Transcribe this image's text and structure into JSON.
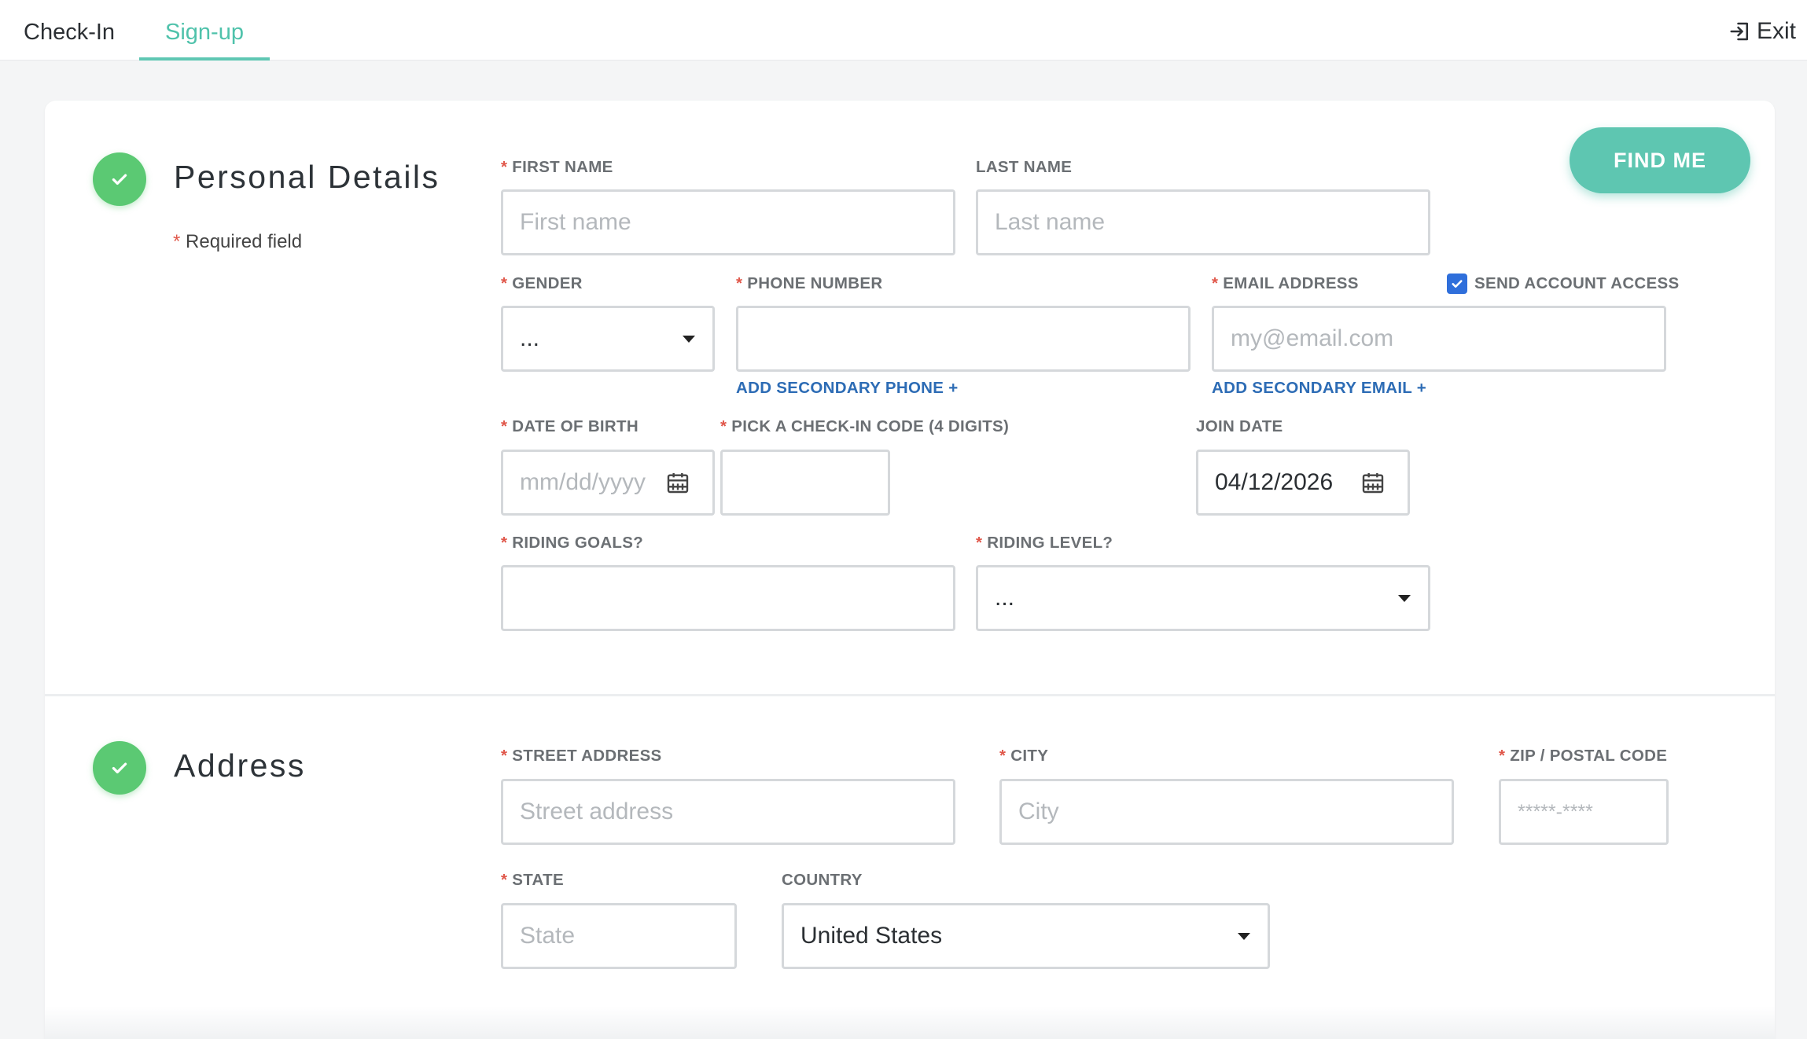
{
  "header": {
    "tabs": [
      {
        "label": "Check-In",
        "active": false
      },
      {
        "label": "Sign-up",
        "active": true
      }
    ],
    "exit_label": "Exit",
    "accent_color": "#4fc2ab"
  },
  "personal": {
    "title": "Personal Details",
    "required_star": "*",
    "required_note": "Required field",
    "find_me_label": "FIND ME",
    "first_name": {
      "label": "FIRST NAME",
      "placeholder": "First name"
    },
    "last_name": {
      "label": "LAST NAME",
      "placeholder": "Last name"
    },
    "gender": {
      "label": "GENDER",
      "value": "..."
    },
    "phone": {
      "label": "PHONE NUMBER",
      "value": "",
      "secondary_link": "ADD SECONDARY PHONE +"
    },
    "email": {
      "label": "EMAIL ADDRESS",
      "placeholder": "my@email.com",
      "secondary_link": "ADD SECONDARY EMAIL +"
    },
    "send_access": {
      "label": "SEND ACCOUNT ACCESS",
      "checked": true
    },
    "dob": {
      "label": "DATE OF BIRTH",
      "placeholder": "mm/dd/yyyy"
    },
    "checkin_code": {
      "label": "PICK A CHECK-IN CODE (4 DIGITS)",
      "value": ""
    },
    "join_date": {
      "label": "JOIN DATE",
      "value": "04/12/2026"
    },
    "riding_goals": {
      "label": "RIDING GOALS?",
      "value": ""
    },
    "riding_level": {
      "label": "RIDING LEVEL?",
      "value": "..."
    }
  },
  "address": {
    "title": "Address",
    "street": {
      "label": "STREET ADDRESS",
      "placeholder": "Street address"
    },
    "city": {
      "label": "CITY",
      "placeholder": "City"
    },
    "zip": {
      "label": "ZIP / POSTAL CODE",
      "placeholder": "*****-****"
    },
    "state": {
      "label": "STATE",
      "placeholder": "State"
    },
    "country": {
      "label": "COUNTRY",
      "value": "United States"
    }
  },
  "colors": {
    "check_green": "#5bc973",
    "required_red": "#e0574a",
    "link_blue": "#2d6cb5",
    "checkbox_blue": "#2f6fdb"
  }
}
